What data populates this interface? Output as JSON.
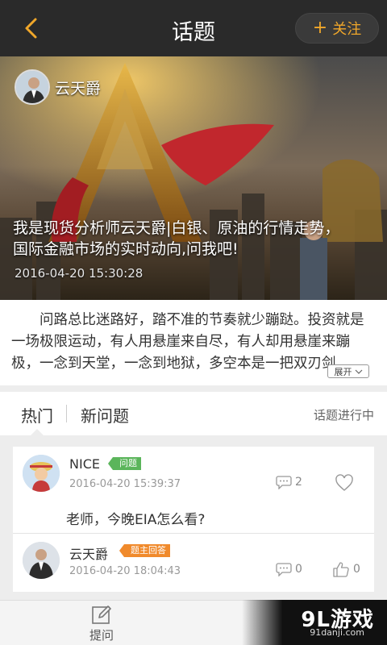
{
  "header": {
    "title": "话题",
    "follow_label": "关注",
    "follow_plus": "+"
  },
  "banner": {
    "author_name": "云天爵",
    "text": "我是现货分析师云天爵|白银、原油的行情走势，国际金融市场的实时动向,问我吧!",
    "time": "2016-04-20 15:30:28"
  },
  "description": {
    "text": "问路总比迷路好，踏不准的节奏就少蹦跶。投资就是一场极限运动，有人用悬崖来自尽，有人却用悬崖来蹦极，一念到天堂，一念到地狱，多空本是一把双刃剑，...",
    "expand_label": "展开"
  },
  "tabs": {
    "hot": "热门",
    "new": "新问题",
    "status": "话题进行中"
  },
  "items": [
    {
      "user": "NICE",
      "badge": "问题",
      "time": "2016-04-20 15:39:37",
      "comments": "2",
      "question": "老师，今晚EIA怎么看?"
    },
    {
      "user": "云天爵",
      "badge": "题主回答",
      "time": "2016-04-20 18:04:43",
      "comments": "0",
      "likes": "0"
    }
  ],
  "bottom": {
    "ask_label": "提问"
  },
  "watermark": {
    "brand": "9L游戏",
    "site": "91danji.com"
  },
  "colors": {
    "accent": "#f0a72a",
    "badge_question": "#5bb55b",
    "badge_answer": "#f08a2c",
    "topbar": "#2a2a2a"
  }
}
